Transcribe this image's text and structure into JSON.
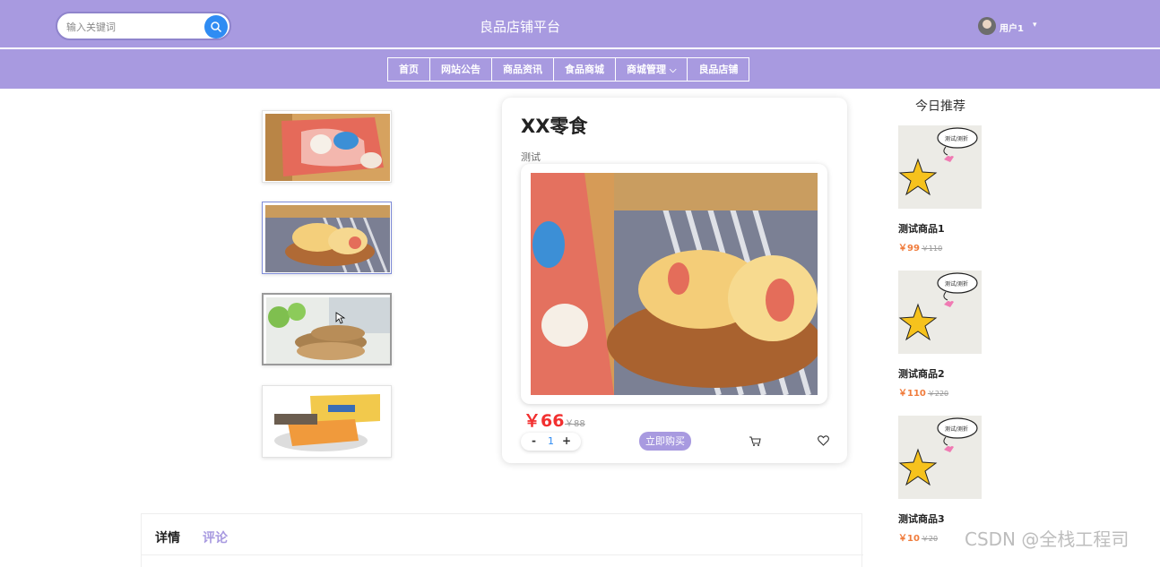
{
  "header": {
    "search_placeholder": "输入关键词",
    "site_title": "良品店铺平台",
    "user_name": "用户1",
    "user_caret": "▾"
  },
  "nav": {
    "items": [
      {
        "label": "首页"
      },
      {
        "label": "网站公告"
      },
      {
        "label": "商品资讯"
      },
      {
        "label": "食品商城"
      },
      {
        "label": "商城管理"
      },
      {
        "label": "良品店铺"
      }
    ]
  },
  "product": {
    "name": "XX零食",
    "subtitle": "测试",
    "price": "￥66",
    "old_price": "￥88",
    "quantity": "1",
    "minus": "-",
    "plus": "+",
    "buy_label": "立即购买"
  },
  "recommend": {
    "title": "今日推荐",
    "items": [
      {
        "name": "测试商品1",
        "price": "￥99",
        "old_price": "￥110"
      },
      {
        "name": "测试商品2",
        "price": "￥110",
        "old_price": "￥220"
      },
      {
        "name": "测试商品3",
        "price": "￥10",
        "old_price": "￥20"
      }
    ],
    "sticker_text": "测试/测折"
  },
  "tabs": {
    "details": "详情",
    "comments": "评论"
  },
  "watermark": "CSDN @全栈工程司",
  "colors": {
    "header_bg": "#a89ae0",
    "price_red": "#f23030",
    "rec_price_orange": "#f07c3c",
    "search_button": "#2f8cf3"
  }
}
